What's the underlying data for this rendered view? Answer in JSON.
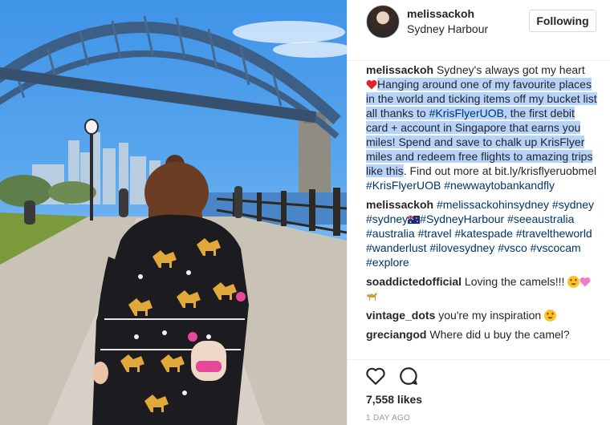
{
  "post": {
    "username": "melissackoh",
    "location": "Sydney Harbour",
    "follow_label": "Following",
    "caption": {
      "username": "melissackoh",
      "text_before_heart": " Sydney's always got my heart ",
      "highlighted_1": "Hanging around one of my favourite places in the world and ticking items off my bucket list all thanks to ",
      "hashtag_kris": "#KrisFlyerUOB",
      "highlighted_2": ", the first debit card + account in Singapore that earns you miles! Spend and save to chalk up KrisFlyer miles and redeem free flights to amazing trips like this",
      "after": ". Find out more at bit.ly/krisflyeruobmel ",
      "hashtag_kris2": "#KrisFlyerUOB",
      "hashtag_new": "#newwaytobankandfly"
    },
    "comments": [
      {
        "username": "melissackoh",
        "tags_a": "#melissackohinsydney #sydney #sydney",
        "tags_b": "#SydneyHarbour #seeaustralia #australia #travel #katespade #traveltheworld #wanderlust #ilovesydney #vsco #vscocam #explore"
      },
      {
        "username": "soaddictedofficial",
        "text": "Loving the camels!!!"
      },
      {
        "username": "vintage_dots",
        "text": "you're my inspiration"
      },
      {
        "username": "greciangod",
        "text": "Where did u buy the camel?"
      }
    ],
    "likes": "7,558 likes",
    "time": "1 DAY AGO",
    "icons": [
      "heart-icon",
      "comment-icon"
    ]
  }
}
